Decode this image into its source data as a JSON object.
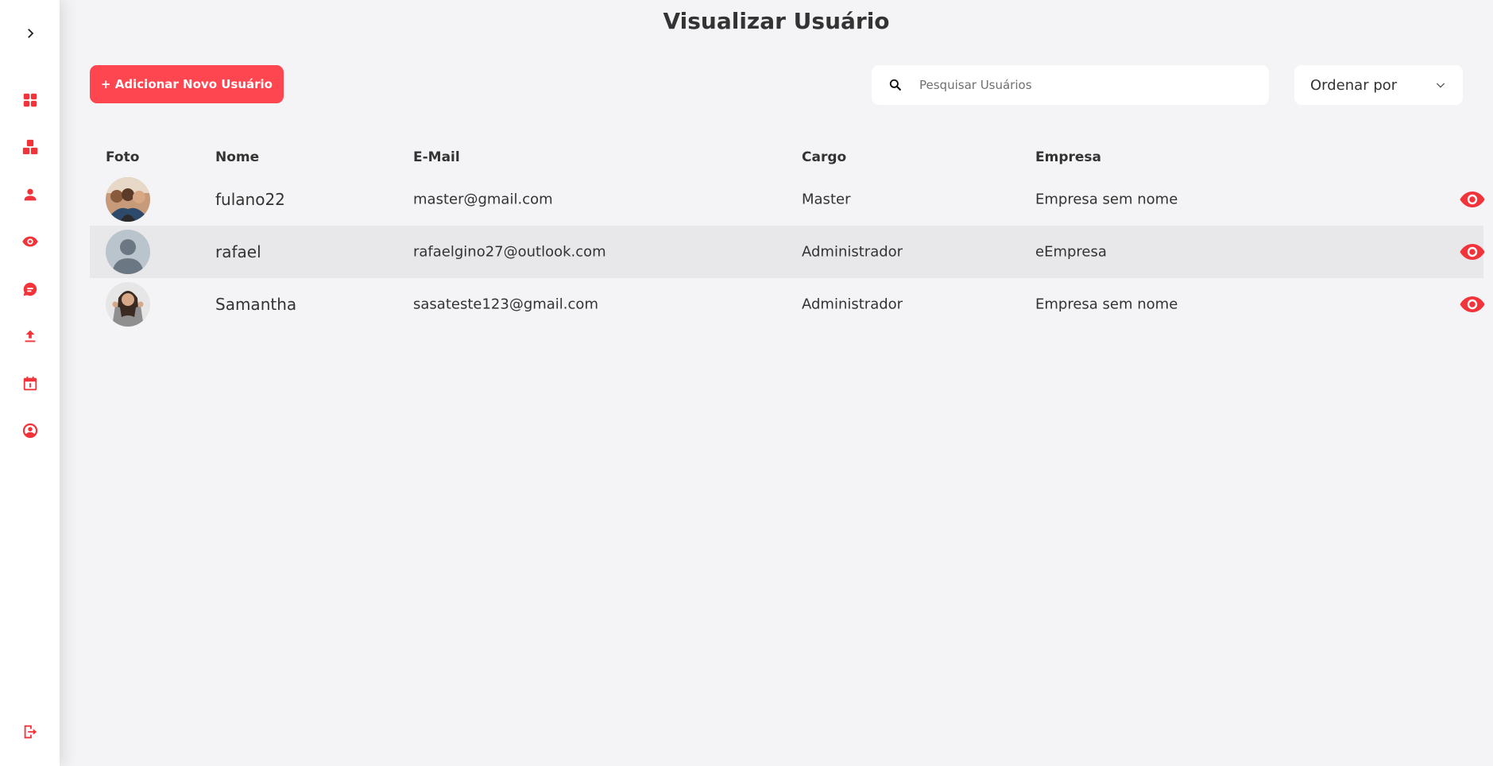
{
  "page": {
    "title": "Visualizar Usuário"
  },
  "toolbar": {
    "add_label": "+ Adicionar Novo Usuário",
    "search_placeholder": "Pesquisar Usuários",
    "order_label": "Ordenar por"
  },
  "sidebar": {
    "items": [
      {
        "icon": "chevron-right-icon"
      },
      {
        "icon": "dashboard-icon"
      },
      {
        "icon": "blocks-icon"
      },
      {
        "icon": "person-icon"
      },
      {
        "icon": "eye-icon"
      },
      {
        "icon": "chat-icon"
      },
      {
        "icon": "upload-icon"
      },
      {
        "icon": "calendar-icon"
      },
      {
        "icon": "account-circle-icon"
      },
      {
        "icon": "logout-icon"
      }
    ]
  },
  "table": {
    "headers": {
      "foto": "Foto",
      "nome": "Nome",
      "email": "E-Mail",
      "cargo": "Cargo",
      "empresa": "Empresa"
    },
    "rows": [
      {
        "nome": "fulano22",
        "email": "master@gmail.com",
        "cargo": "Master",
        "empresa": "Empresa sem nome",
        "avatar": "group-photo"
      },
      {
        "nome": "rafael",
        "email": "rafaelgino27@outlook.com",
        "cargo": "Administrador",
        "empresa": "eEmpresa",
        "avatar": "default-placeholder"
      },
      {
        "nome": "Samantha",
        "email": "sasateste123@gmail.com",
        "cargo": "Administrador",
        "empresa": "Empresa sem nome",
        "avatar": "woman-photo"
      }
    ]
  },
  "colors": {
    "accent": "#fd4650",
    "icon_red": "#f2333a",
    "background": "#f4f4f6",
    "row_highlight": "#e8e8eb"
  }
}
